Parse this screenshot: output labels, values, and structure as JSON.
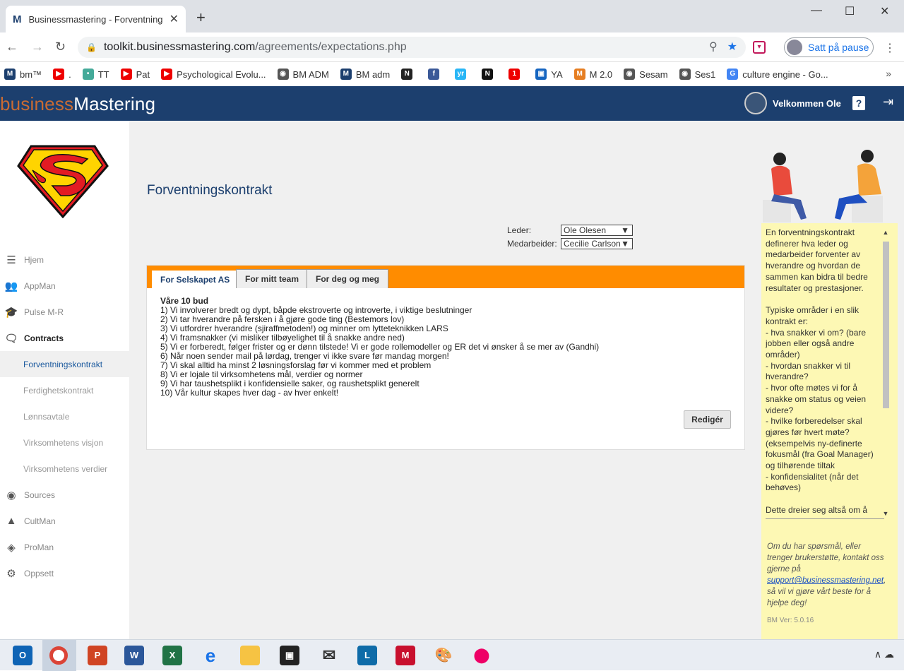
{
  "browser": {
    "tab_title": "Businessmastering - Forventning",
    "tab_favicon": "M",
    "url_host": "toolkit.businessmastering.com",
    "url_path": "/agreements/expectations.php",
    "profile_label": "Satt på pause",
    "bookmarks": [
      {
        "label": "bm™",
        "icon": "bm-icon",
        "color": "#1c3f6e",
        "glyph": "M"
      },
      {
        "label": ".",
        "icon": "youtube-icon",
        "color": "#e00",
        "glyph": "▶"
      },
      {
        "label": "TT",
        "icon": "tt-icon",
        "color": "#4a9",
        "glyph": "•"
      },
      {
        "label": "Pat",
        "icon": "youtube-icon",
        "color": "#e00",
        "glyph": "▶"
      },
      {
        "label": "Psychological Evolu...",
        "icon": "youtube-icon",
        "color": "#e00",
        "glyph": "▶"
      },
      {
        "label": "BM ADM",
        "icon": "globe-icon",
        "color": "#555",
        "glyph": "◉"
      },
      {
        "label": "BM adm",
        "icon": "bm-icon",
        "color": "#1c3f6e",
        "glyph": "M"
      },
      {
        "label": "",
        "icon": "nrk-icon",
        "color": "#222",
        "glyph": "N"
      },
      {
        "label": "",
        "icon": "facebook-icon",
        "color": "#3b5998",
        "glyph": "f"
      },
      {
        "label": "",
        "icon": "yr-icon",
        "color": "#29b6f6",
        "glyph": "yr"
      },
      {
        "label": "",
        "icon": "n-icon",
        "color": "#111",
        "glyph": "N"
      },
      {
        "label": "",
        "icon": "one-icon",
        "color": "#e00",
        "glyph": "1"
      },
      {
        "label": "YA",
        "icon": "ya-icon",
        "color": "#1565c0",
        "glyph": "▣"
      },
      {
        "label": "M 2.0",
        "icon": "bm-icon",
        "color": "#e67e22",
        "glyph": "M"
      },
      {
        "label": "Sesam",
        "icon": "globe-icon",
        "color": "#555",
        "glyph": "◉"
      },
      {
        "label": "Ses1",
        "icon": "globe-icon",
        "color": "#555",
        "glyph": "◉"
      },
      {
        "label": "culture engine - Go...",
        "icon": "google-icon",
        "color": "#4285f4",
        "glyph": "G"
      }
    ]
  },
  "header": {
    "logo_part1": "business",
    "logo_part2": "Mastering",
    "welcome": "Velkommen Ole",
    "help": "?"
  },
  "sidebar": {
    "items": [
      {
        "label": "Hjem",
        "icon": "list-icon",
        "glyph": "☰"
      },
      {
        "label": "AppMan",
        "icon": "users-icon",
        "glyph": "👥"
      },
      {
        "label": "Pulse M-R",
        "icon": "graduation-icon",
        "glyph": "🎓"
      },
      {
        "label": "Contracts",
        "icon": "chat-icon",
        "glyph": "🗨"
      },
      {
        "label": "Forventningskontrakt"
      },
      {
        "label": "Ferdighetskontrakt"
      },
      {
        "label": "Lønnsavtale"
      },
      {
        "label": "Virksomhetens visjon"
      },
      {
        "label": "Virksomhetens verdier"
      },
      {
        "label": "Sources",
        "icon": "globe-icon",
        "glyph": "◉"
      },
      {
        "label": "CultMan",
        "icon": "mountain-icon",
        "glyph": "▲"
      },
      {
        "label": "ProMan",
        "icon": "layers-icon",
        "glyph": "◈"
      },
      {
        "label": "Oppsett",
        "icon": "gear-icon",
        "glyph": "⚙"
      }
    ]
  },
  "main": {
    "title": "Forventningskontrakt",
    "leder_label": "Leder:",
    "leder_value": "Ole Olesen",
    "medarbeider_label": "Medarbeider:",
    "medarbeider_value": "Cecilie Carlson",
    "tabs": [
      "For Selskapet AS",
      "For mitt team",
      "For deg og meg"
    ],
    "heading": "Våre 10 bud",
    "lines": [
      "1) Vi involverer bredt og dypt, båpde ekstroverte og introverte, i viktige beslutninger",
      "2) Vi tar hverandre på fersken i å gjøre gode ting (Bestemors lov)",
      "3) Vi utfordrer hverandre (sjiraffmetoden!) og minner om lytteteknikken LARS",
      "4) Vi framsnakker (vi misliker tilbøyelighet til å snakke andre ned)",
      "5) Vi er forberedt, følger frister og er dønn tilstede! Vi er gode rollemodeller og ER det vi ønsker å se mer av (Gandhi)",
      "6) Når noen sender mail på lørdag, trenger vi ikke svare før mandag morgen!",
      "7) Vi skal alltid ha minst 2 løsningsforslag før vi kommer med et problem",
      "8) Vi er lojale til virksomhetens mål, verdier og normer",
      "9) Vi har taushetsplikt i konfidensielle saker, og raushetsplikt generelt",
      "10) Vår kultur skapes hver dag - av hver enkelt!"
    ],
    "edit_label": "Redigér"
  },
  "info": {
    "p1": "En forventningskontrakt definerer hva leder og medarbeider forventer av hverandre og hvordan de sammen kan bidra til bedre resultater og prestasjoner.",
    "p2_lines": [
      "Typiske områder i en slik kontrakt er:",
      "- hva snakker vi om? (bare jobben eller også andre områder)",
      "- hvordan snakker vi til hverandre?",
      "- hvor ofte møtes vi for å snakke om status og veien videre?",
      "- hvilke forberedelser skal gjøres før hvert møte? (eksempelvis ny-definerte fokusmål (fra Goal Manager) og tilhørende tiltak",
      "- konfidensialitet (når det behøves)"
    ],
    "p3": "Dette dreier seg altså om å",
    "support_text": "Om du har spørsmål, eller trenger brukerstøtte, kontakt oss gjerne på",
    "support_email": "support@businessmastering.net",
    "support_tail": ", så vil vi gjøre vårt beste for å hjelpe deg!",
    "version": "BM Ver: 5.0.16"
  },
  "colors": {
    "navy": "#1c3f6e",
    "orange": "#ff8c00",
    "note": "#fdf8b4"
  }
}
